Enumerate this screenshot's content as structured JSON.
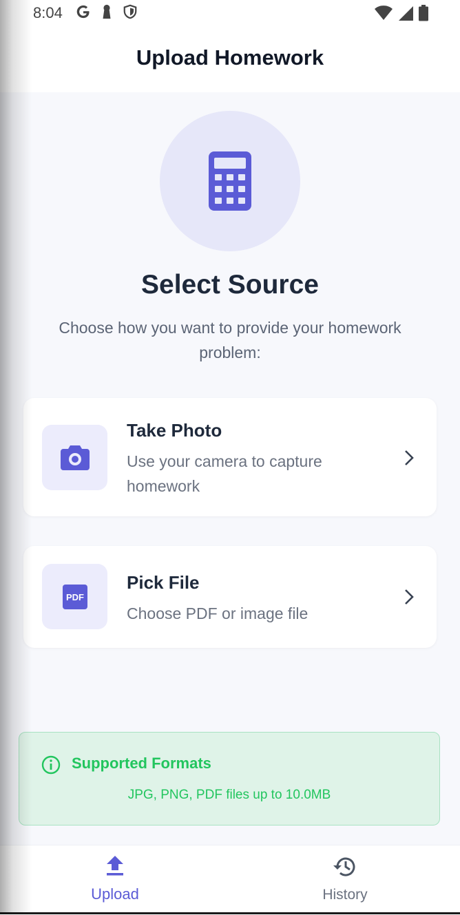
{
  "status_bar": {
    "time": "8:04",
    "left_icons": [
      "google-icon",
      "keyhole-icon",
      "shield-icon"
    ],
    "right_icons": [
      "wifi-icon",
      "cell-signal-icon",
      "battery-icon"
    ]
  },
  "app_bar": {
    "title": "Upload Homework"
  },
  "hero": {
    "icon": "calculator-icon",
    "circle_color": "#e6e7f9",
    "accent": "#5b5bd6"
  },
  "headline": "Select Source",
  "subtitle": "Choose how you want to provide your homework problem:",
  "options": [
    {
      "icon": "camera-icon",
      "title": "Take Photo",
      "description": "Use your camera to capture homework"
    },
    {
      "icon": "pdf-icon",
      "title": "Pick File",
      "description": "Choose PDF or image file"
    }
  ],
  "info": {
    "icon": "info-icon",
    "title": "Supported Formats",
    "description": "JPG, PNG, PDF files up to 10.0MB",
    "color": "#22c55e"
  },
  "bottom_nav": {
    "items": [
      {
        "icon": "upload-icon",
        "label": "Upload",
        "active": true
      },
      {
        "icon": "history-icon",
        "label": "History",
        "active": false
      }
    ],
    "active_color": "#5b5bd6",
    "inactive_color": "#6b7280"
  }
}
